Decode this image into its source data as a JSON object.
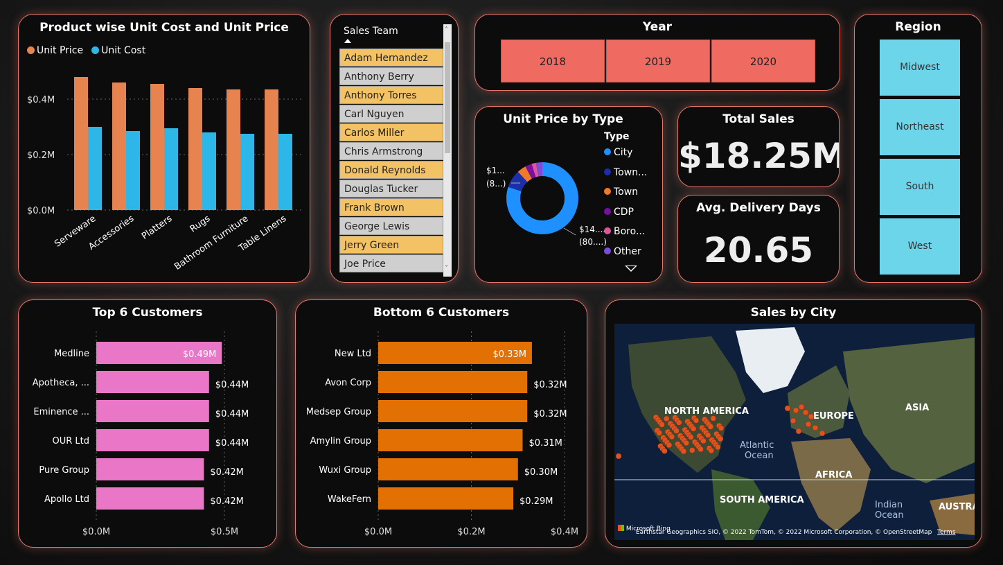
{
  "product_chart": {
    "title": "Product wise Unit Cost and Unit Price",
    "legend": [
      {
        "name": "Unit Price",
        "color": "#e6834f"
      },
      {
        "name": "Unit Cost",
        "color": "#2db7e8"
      }
    ],
    "y_ticks": [
      "$0.0M",
      "$0.2M",
      "$0.4M"
    ]
  },
  "sales_team": {
    "header": "Sales Team",
    "items": [
      {
        "label": "Adam Hernandez",
        "selected": true
      },
      {
        "label": "Anthony Berry",
        "selected": false
      },
      {
        "label": "Anthony Torres",
        "selected": true
      },
      {
        "label": "Carl Nguyen",
        "selected": false
      },
      {
        "label": "Carlos Miller",
        "selected": true
      },
      {
        "label": "Chris Armstrong",
        "selected": false
      },
      {
        "label": "Donald Reynolds",
        "selected": true
      },
      {
        "label": "Douglas Tucker",
        "selected": false
      },
      {
        "label": "Frank Brown",
        "selected": true
      },
      {
        "label": "George Lewis",
        "selected": false
      },
      {
        "label": "Jerry Green",
        "selected": true
      },
      {
        "label": "Joe Price",
        "selected": false
      }
    ]
  },
  "year": {
    "title": "Year",
    "options": [
      "2018",
      "2019",
      "2020"
    ]
  },
  "region": {
    "title": "Region",
    "options": [
      "Midwest",
      "Northeast",
      "South",
      "West"
    ]
  },
  "unit_price_type": {
    "title": "Unit Price by Type",
    "legend_title": "Type",
    "legend": [
      {
        "name": "City",
        "color": "#1e90ff"
      },
      {
        "name": "Town...",
        "color": "#1a2fa8"
      },
      {
        "name": "Town",
        "color": "#f07a2a"
      },
      {
        "name": "CDP",
        "color": "#7a0fa0"
      },
      {
        "name": "Boro...",
        "color": "#e0559a"
      },
      {
        "name": "Other",
        "color": "#7a4cd9"
      }
    ],
    "label_small_a": "$1...",
    "label_small_b": "(8...)",
    "label_big_a": "$14....",
    "label_big_b": "(80....)"
  },
  "total_sales": {
    "title": "Total Sales",
    "value": "$18.25M"
  },
  "avg_delivery": {
    "title": "Avg. Delivery Days",
    "value": "20.65"
  },
  "top_customers": {
    "title": "Top 6 Customers",
    "x_ticks": [
      "$0.0M",
      "$0.5M"
    ]
  },
  "bottom_customers": {
    "title": "Bottom 6 Customers",
    "x_ticks": [
      "$0.0M",
      "$0.2M",
      "$0.4M"
    ]
  },
  "sales_by_city": {
    "title": "Sales by City",
    "labels": {
      "north_america": "NORTH AMERICA",
      "europe": "EUROPE",
      "asia": "ASIA",
      "atlantic": "Atlantic",
      "ocean": "Ocean",
      "africa": "AFRICA",
      "south_america": "SOUTH AMERICA",
      "indian": "Indian",
      "ocean2": "Ocean",
      "australia": "AUSTRAI"
    },
    "attribution": "Earthstar Geographics SIO, © 2022 TomTom, © 2022 Microsoft Corporation, © OpenStreetMap",
    "terms": "Terms",
    "bing": "Microsoft Bing"
  },
  "chart_data": [
    {
      "type": "bar",
      "title": "Product wise Unit Cost and Unit Price",
      "categories": [
        "Serveware",
        "Accessories",
        "Platters",
        "Rugs",
        "Bathroom Furniture",
        "Table Linens"
      ],
      "series": [
        {
          "name": "Unit Price",
          "values": [
            0.48,
            0.46,
            0.455,
            0.44,
            0.435,
            0.435
          ]
        },
        {
          "name": "Unit Cost",
          "values": [
            0.3,
            0.285,
            0.295,
            0.28,
            0.275,
            0.275
          ]
        }
      ],
      "ylim": [
        0,
        0.5
      ]
    },
    {
      "type": "pie",
      "title": "Unit Price by Type",
      "categories": [
        "City",
        "Town...",
        "Town",
        "CDP",
        "Boro...",
        "Other"
      ],
      "values": [
        80,
        8,
        4,
        3,
        2,
        3
      ]
    },
    {
      "type": "bar",
      "title": "Top 6 Customers",
      "categories": [
        "Medline",
        "Apotheca, ...",
        "Eminence ...",
        "OUR Ltd",
        "Pure Group",
        "Apollo Ltd"
      ],
      "values": [
        0.49,
        0.44,
        0.44,
        0.44,
        0.42,
        0.42
      ],
      "labels": [
        "$0.49M",
        "$0.44M",
        "$0.44M",
        "$0.44M",
        "$0.42M",
        "$0.42M"
      ],
      "xlim": [
        0,
        0.5
      ]
    },
    {
      "type": "bar",
      "title": "Bottom 6 Customers",
      "categories": [
        "New Ltd",
        "Avon Corp",
        "Medsep Group",
        "Amylin Group",
        "Wuxi Group",
        "WakeFern"
      ],
      "values": [
        0.33,
        0.32,
        0.32,
        0.31,
        0.3,
        0.29
      ],
      "labels": [
        "$0.33M",
        "$0.32M",
        "$0.32M",
        "$0.31M",
        "$0.30M",
        "$0.29M"
      ],
      "xlim": [
        0,
        0.4
      ]
    }
  ]
}
